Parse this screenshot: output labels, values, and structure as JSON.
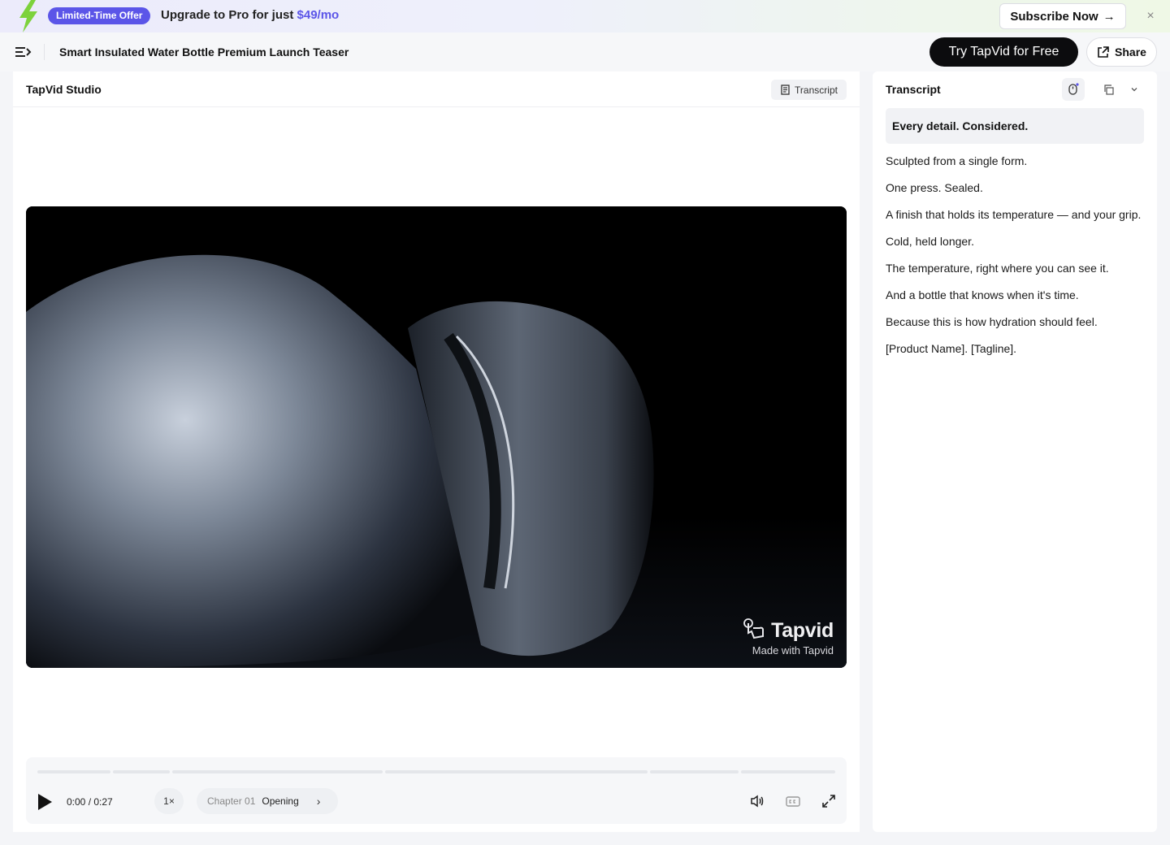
{
  "promo": {
    "badge": "Limited-Time Offer",
    "text": "Upgrade to Pro for just ",
    "price": "$49/mo",
    "cta": "Subscribe Now",
    "cta_arrow": "→",
    "close_icon": "×",
    "accent": "#5b55e8"
  },
  "header": {
    "title": "Smart Insulated Water Bottle Premium Launch Teaser",
    "try_label": "Try TapVid for Free",
    "share_label": "Share"
  },
  "studio": {
    "name": "TapVid Studio",
    "transcript_button": "Transcript",
    "watermark_brand": "Tapvid",
    "watermark_text": "Made with Tapvid"
  },
  "player": {
    "time": "0:00 / 0:27",
    "speed": "1×",
    "chapter_number": "Chapter 01",
    "chapter_label": "Opening",
    "chevron": "›",
    "progress": 0
  },
  "transcript": {
    "title": "Transcript",
    "active_line": "Every detail. Considered.",
    "lines": [
      "Sculpted from a single form.",
      "One press. Sealed.",
      "A finish that holds its temperature — and your grip.",
      "Cold, held longer.",
      "The temperature, right where you can see it.",
      "And a bottle that knows when it's time.",
      "Because this is how hydration should feel.",
      "[Product Name]. [Tagline]."
    ]
  }
}
